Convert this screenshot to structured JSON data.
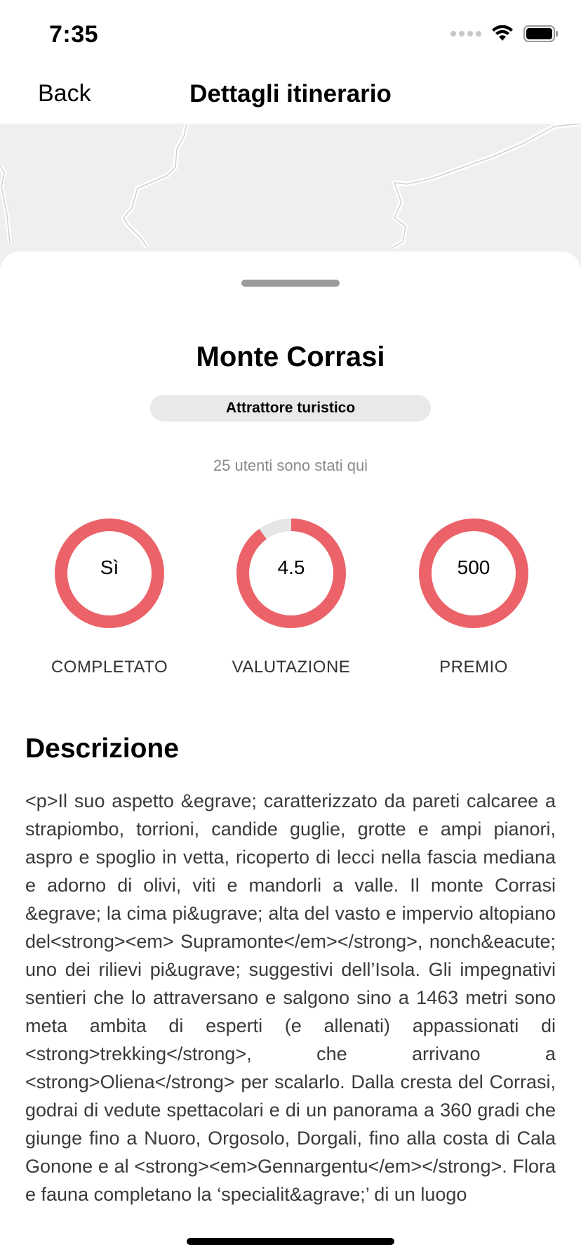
{
  "status_bar": {
    "time": "7:35"
  },
  "nav": {
    "back_label": "Back",
    "title": "Dettagli itinerario"
  },
  "place": {
    "title": "Monte Corrasi",
    "category": "Attrattore turistico",
    "visitors": "25 utenti sono stati qui"
  },
  "stats": [
    {
      "value": "Sì",
      "label": "COMPLETATO",
      "fill": 1.0
    },
    {
      "value": "4.5",
      "label": "VALUTAZIONE",
      "fill": 0.9
    },
    {
      "value": "500",
      "label": "PREMIO",
      "fill": 1.0
    }
  ],
  "colors": {
    "accent": "#ec6269",
    "track": "#e6e6e6"
  },
  "description": {
    "title": "Descrizione",
    "body": "<p>Il suo aspetto &egrave; caratterizzato da pareti calcaree a strapiombo, torrioni, candide guglie, grotte e ampi pianori, aspro e spoglio in vetta, ricoperto di lecci nella fascia mediana e adorno di olivi, viti e mandorli a valle. Il monte Corrasi &egrave; la cima pi&ugrave; alta del vasto e impervio altopiano del<strong><em> Supramonte</em></strong>, nonch&eacute; uno dei rilievi pi&ugrave; suggestivi dell’Isola. Gli impegnativi sentieri che lo attraversano e salgono sino a 1463 metri sono meta ambita di esperti (e allenati) appassionati di <strong>trekking</strong>, che arrivano a <strong>Oliena</strong> per scalarlo. Dalla cresta del Corrasi, godrai di vedute spettacolari e di un panorama a 360 gradi che giunge fino a Nuoro, Orgosolo, Dorgali, fino alla costa di Cala Gonone e al <strong><em>Gennargentu</em></strong>. Flora e fauna completano la ‘specialit&agrave;’ di un luogo"
  }
}
